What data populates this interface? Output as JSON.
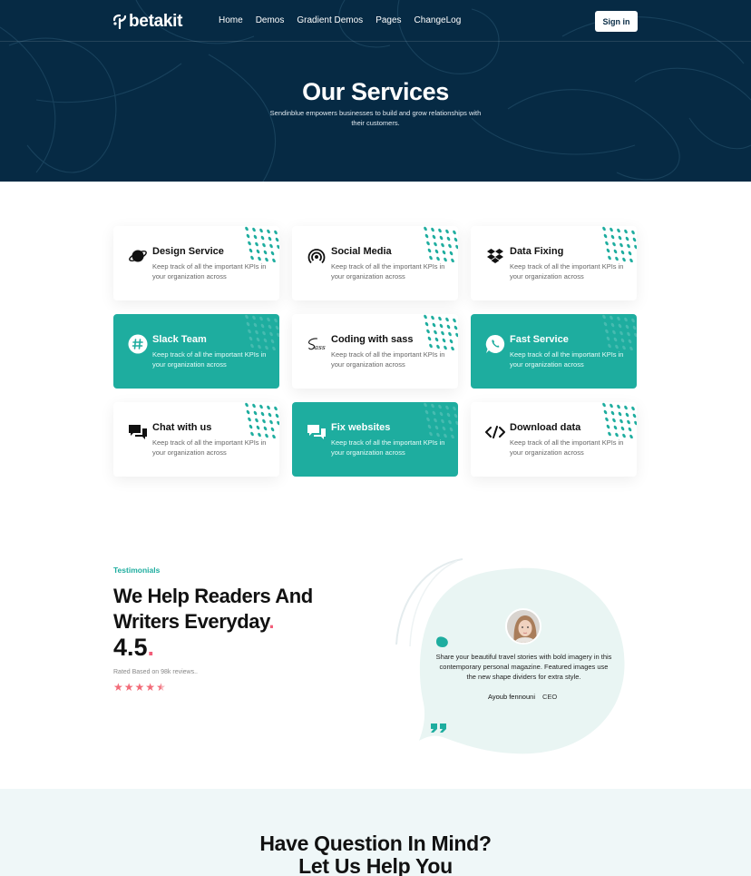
{
  "nav": {
    "logo_text": "betakit",
    "links": [
      "Home",
      "Demos",
      "Gradient Demos",
      "Pages",
      "ChangeLog"
    ],
    "signin_label": "Sign in"
  },
  "hero": {
    "title": "Our Services",
    "subtitle": "Sendinblue empowers businesses to build and grow relationships with their customers."
  },
  "services": [
    {
      "title": "Design Service",
      "text": "Keep track of all the important KPIs in your organization across",
      "icon": "planet-icon",
      "teal": false
    },
    {
      "title": "Social Media",
      "text": "Keep track of all the important KPIs in your organization across",
      "icon": "broadcast-icon",
      "teal": false
    },
    {
      "title": "Data Fixing",
      "text": "Keep track of all the important KPIs in your organization across",
      "icon": "dropbox-icon",
      "teal": false
    },
    {
      "title": "Slack Team",
      "text": "Keep track of all the important KPIs in your organization across",
      "icon": "slack-icon",
      "teal": true
    },
    {
      "title": "Coding with sass",
      "text": "Keep track of all the important KPIs in your organization across",
      "icon": "sass-icon",
      "teal": false
    },
    {
      "title": "Fast Service",
      "text": "Keep track of all the important KPIs in your organization across",
      "icon": "whatsapp-icon",
      "teal": true
    },
    {
      "title": "Chat with us",
      "text": "Keep track of all the important KPIs in your organization across",
      "icon": "chat-icon",
      "teal": false
    },
    {
      "title": "Fix websites",
      "text": "Keep track of all the important KPIs in your organization across",
      "icon": "chat-icon",
      "teal": true
    },
    {
      "title": "Download data",
      "text": "Keep track of all the important KPIs in your organization across",
      "icon": "code-arrows-icon",
      "teal": false
    }
  ],
  "testimonials": {
    "label": "Testimonials",
    "heading": "We Help Readers And Writers Everyday",
    "heading_dot": ".",
    "rating": "4.5",
    "rating_dot": ".",
    "reviews": "Rated Based on 98k reviews..",
    "stars": 4.5,
    "quote": "Share your beautiful travel stories with bold imagery in this contemporary personal magazine. Featured images use the new shape dividers for extra style.",
    "author": "Ayoub fennouni",
    "role": "CEO"
  },
  "faq": {
    "title_line1": "Have Question In Mind?",
    "title_line2": "Let Us Help You"
  },
  "colors": {
    "navy": "#062a44",
    "teal": "#1ead9f",
    "pink": "#f25f7a",
    "light_bg": "#eff7f8"
  }
}
